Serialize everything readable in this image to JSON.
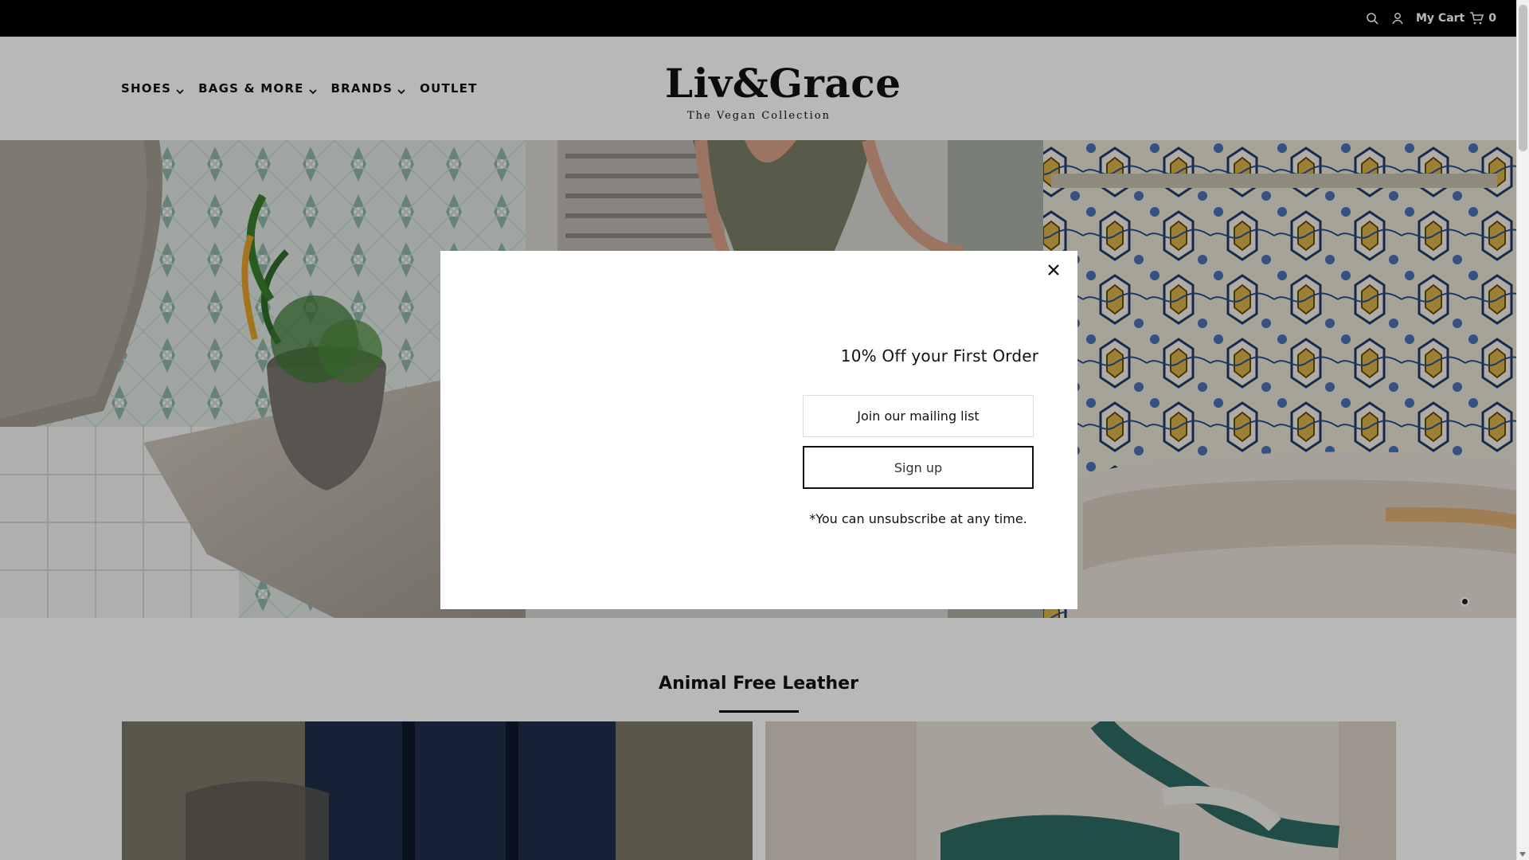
{
  "topbar": {
    "cart_label": "My Cart",
    "cart_count": "0",
    "icons": [
      "search-icon",
      "user-icon",
      "cart-icon"
    ]
  },
  "nav": {
    "items": [
      {
        "label": "SHOES",
        "has_dropdown": true
      },
      {
        "label": "BAGS & MORE",
        "has_dropdown": true
      },
      {
        "label": "BRANDS",
        "has_dropdown": true
      },
      {
        "label": "OUTLET",
        "has_dropdown": false
      }
    ]
  },
  "logo": {
    "brand": "Liv&Grace",
    "tagline": "The Vegan Collection"
  },
  "modal": {
    "offer": "10% Off your First Order",
    "input_placeholder": "Join our mailing list",
    "signup_label": "Sign up",
    "note": "*You can unsubscribe at any time."
  },
  "section": {
    "title": "Animal Free Leather"
  },
  "colors": {
    "topbar_bg": "#000000",
    "overlay": "rgba(0,0,0,0.28)",
    "accent": "#111111"
  }
}
